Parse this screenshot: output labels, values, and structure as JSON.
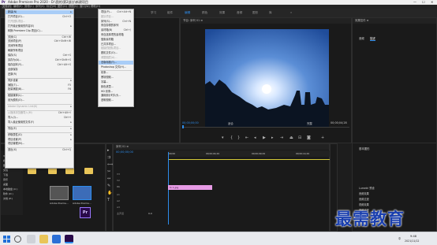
{
  "window": {
    "title": "Adobe Premiere Pro 2020 - D:\\我的\\第2部分\\新建项目",
    "min": "—",
    "max": "☐",
    "close": "✕"
  },
  "menubar": [
    "文件(F)",
    "编辑(E)",
    "剪辑(C)",
    "序列(S)",
    "标记(M)",
    "图形(G)",
    "视图(V)",
    "窗口(W)",
    "帮助(H)"
  ],
  "workspaces": [
    "学习",
    "组件",
    "编辑",
    "颜色",
    "效果",
    "音频",
    "图形",
    "库"
  ],
  "file_menu": [
    {
      "label": "新建(N)",
      "arrow": "▸",
      "hl": true
    },
    {
      "label": "打开项目(O)...",
      "sc": "Ctrl+O"
    },
    {
      "label": "打开团队项目...",
      "dis": true
    },
    {
      "label": "打开最近使用的内容(E)",
      "arrow": "▸"
    },
    {
      "label": "转换 Premiere Clip 项目(C)..."
    },
    {
      "sep": true
    },
    {
      "label": "关闭(C)",
      "sc": "Ctrl+W"
    },
    {
      "label": "关闭项目(P)",
      "sc": "Ctrl+Shift+W"
    },
    {
      "label": "关闭所有项目"
    },
    {
      "label": "刷新所有项目"
    },
    {
      "label": "保存(S)",
      "sc": "Ctrl+S"
    },
    {
      "label": "另存为(A)...",
      "sc": "Ctrl+Shift+S"
    },
    {
      "label": "保存副本(Y)...",
      "sc": "Ctrl+Alt+S"
    },
    {
      "label": "全部保存"
    },
    {
      "label": "还原(R)"
    },
    {
      "sep": true
    },
    {
      "label": "同步设置",
      "arrow": "▸"
    },
    {
      "label": "捕捉(T)...",
      "sc": "F5"
    },
    {
      "label": "批量捕捉(B)...",
      "sc": "F6"
    },
    {
      "sep": true
    },
    {
      "label": "链接媒体(L)..."
    },
    {
      "label": "设为脱机(O)..."
    },
    {
      "sep": true
    },
    {
      "label": "Adobe Dynamic Link(K)",
      "arrow": "▸",
      "dis": true
    },
    {
      "sep": true
    },
    {
      "label": "从媒体浏览器导入(M)",
      "sc": "Ctrl+Alt+I",
      "dis": true
    },
    {
      "label": "导入(I)...",
      "sc": "Ctrl+I"
    },
    {
      "label": "导入最近使用的文件(F)",
      "arrow": "▸"
    },
    {
      "sep": true
    },
    {
      "label": "导出(E)",
      "arrow": "▸"
    },
    {
      "sep": true
    },
    {
      "label": "获取属性(G)",
      "arrow": "▸"
    },
    {
      "label": "项目设置(P)",
      "arrow": "▸"
    },
    {
      "label": "项目管理(M)..."
    },
    {
      "sep": true
    },
    {
      "label": "退出(X)",
      "sc": "Ctrl+Q"
    }
  ],
  "new_submenu": [
    {
      "label": "项目(P)...",
      "sc": "Ctrl+Alt+N"
    },
    {
      "label": "团队项目...",
      "dis": true
    },
    {
      "label": "序列(S)...",
      "sc": "Ctrl+N"
    },
    {
      "label": "来自剪辑的序列"
    },
    {
      "label": "素材箱(B)",
      "sc": "Ctrl+/"
    },
    {
      "label": "来自选择项的素材箱"
    },
    {
      "label": "搜索素材箱"
    },
    {
      "label": "已共享项目..."
    },
    {
      "label": "链接的团队项目...",
      "dis": true
    },
    {
      "label": "脱机文件(O)..."
    },
    {
      "label": "调整图层(A)...",
      "dis": true
    },
    {
      "label": "旧版标题(T)...",
      "hl": true
    },
    {
      "label": "Photoshop 文件(H)..."
    },
    {
      "sep": true
    },
    {
      "label": "彩条..."
    },
    {
      "label": "黑场视频..."
    },
    {
      "label": "字幕..."
    },
    {
      "label": "颜色遮罩..."
    },
    {
      "label": "HD 彩条..."
    },
    {
      "label": "通用倒计时片头..."
    },
    {
      "label": "透明视频..."
    }
  ],
  "program_monitor": {
    "title": "节目: 序列 01 ≡",
    "timecode_left": "00;00;00;00",
    "fit": "适合",
    "quality": "完整",
    "timecode_right": "00;00;04;28"
  },
  "right_panel": {
    "title": "效果控件 ≡",
    "tabs": [
      "音频",
      "描述"
    ]
  },
  "project_panel": {
    "items": [
      "Adobe Premie...",
      "Adobe Premie..."
    ],
    "folders": [
      "My Project",
      "录制",
      "Adobe",
      "Premiere",
      "新建文件夹"
    ]
  },
  "sidebar_tree": [
    "3D 对象",
    "视频",
    "图片",
    "文档",
    "下载",
    "音乐",
    "桌面",
    "本地磁盘 (C:)",
    "软件 (D:)",
    "文档 (E:)"
  ],
  "timeline": {
    "title": "序列 01 ≡",
    "timecode": "00;00;00;00",
    "ruler": [
      "00;00",
      "00;00;04;29",
      "00;00;09;29",
      "00;00;14;29"
    ],
    "tracks": [
      "V3",
      "V2",
      "V1",
      "A1",
      "A2",
      "A3",
      "主声道"
    ],
    "clip_label": "fx 1.jpg",
    "master_value": "0.0"
  },
  "effects_panel": {
    "title": "基本图形",
    "items": [
      "Lumetri 预设",
      "音频效果",
      "音频过渡",
      "视频效果",
      "视频过渡"
    ]
  },
  "watermark": "最需教育",
  "taskbar": {
    "time": "9:48",
    "date": "2021/11/12",
    "lang": "中"
  },
  "colors": {
    "accent": "#2d8ceb",
    "clip": "#e79be5",
    "premiere": "#2a0a4a"
  }
}
